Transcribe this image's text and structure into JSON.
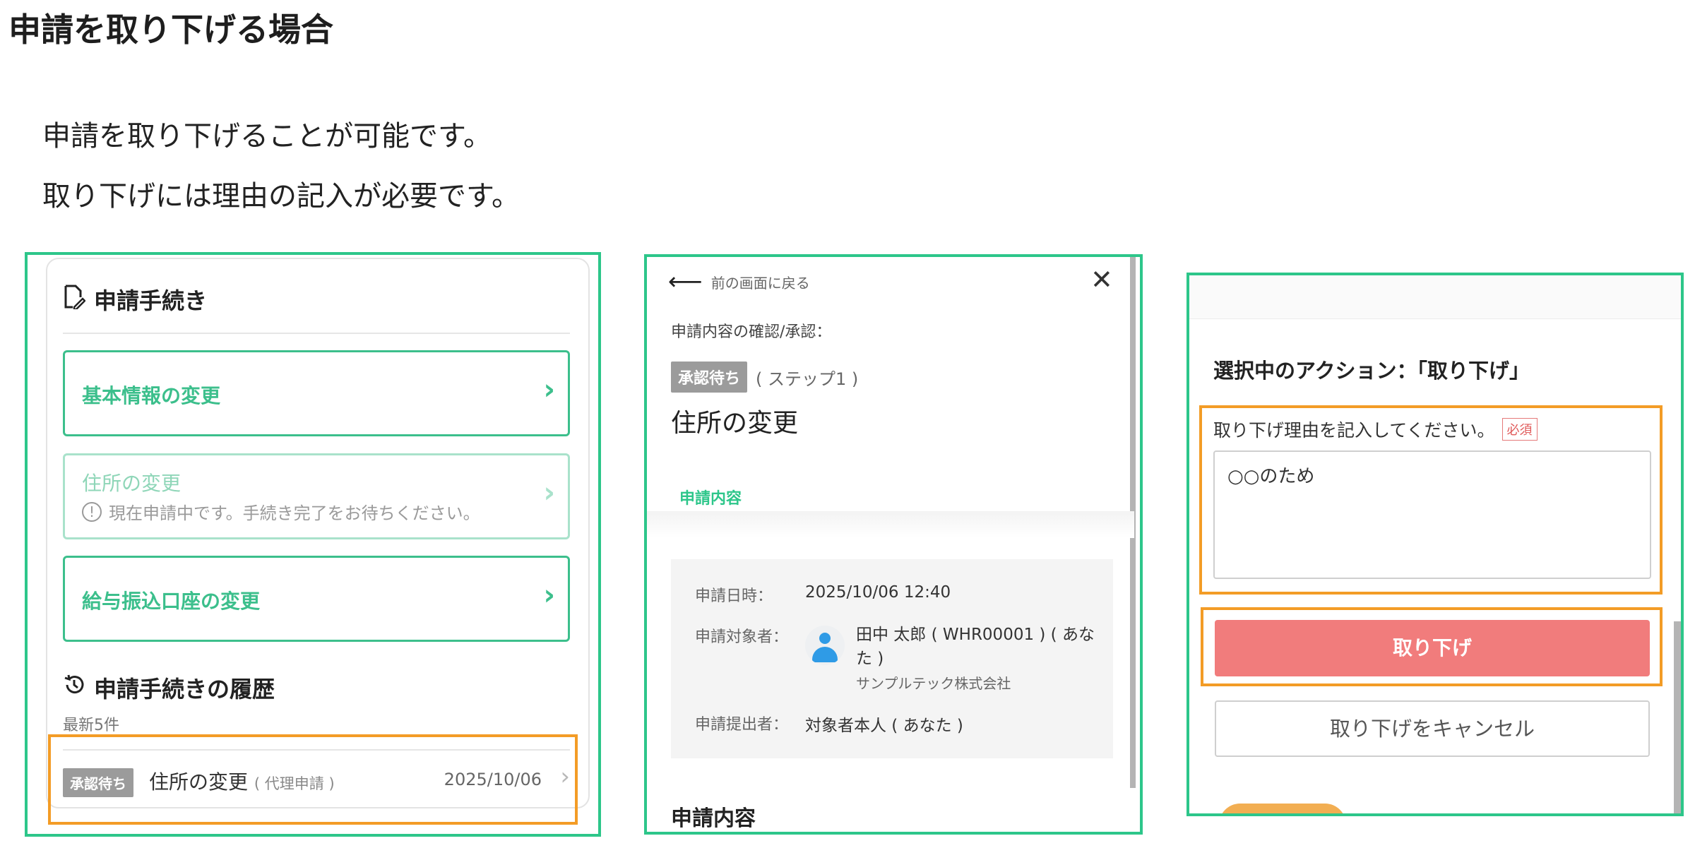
{
  "page": {
    "heading": "申請を取り下げる場合",
    "intro_line1": "申請を取り下げることが可能です。",
    "intro_line2": "取り下げには理由の記入が必要です。"
  },
  "panel1": {
    "title": "申請手続き",
    "menu": [
      {
        "label": "基本情報の変更"
      },
      {
        "label": "住所の変更",
        "note": "現在申請中です。手続き完了をお待ちください。"
      },
      {
        "label": "給与振込口座の変更"
      }
    ],
    "chevron": "›",
    "info_symbol": "!",
    "history_title": "申請手続きの履歴",
    "history_subtitle": "最新5件",
    "history_item": {
      "badge": "承認待ち",
      "name": "住所の変更",
      "sub": "( 代理申請 )",
      "date": "2025/10/06"
    }
  },
  "panel2": {
    "back_label": "前の画面に戻る",
    "back_arrow": "⟵",
    "close_symbol": "✕",
    "section_label": "申請内容の確認/承認：",
    "status_badge": "承認待ち",
    "step": "( ステップ1 )",
    "title": "住所の変更",
    "tab": "申請内容",
    "info": {
      "date_label": "申請日時：",
      "date_value": "2025/10/06 12:40",
      "target_label": "申請対象者：",
      "target_value": "田中 太郎 ( WHR00001 ) ( あなた )",
      "company": "サンプルテック株式会社",
      "submitter_label": "申請提出者：",
      "submitter_value": "対象者本人 ( あなた )"
    },
    "bottom_heading": "申請内容"
  },
  "panel3": {
    "action_label": "選択中のアクション：「取り下げ」",
    "reason_label": "取り下げ理由を記入してください。",
    "required_badge": "必須",
    "reason_value": "○○のため",
    "withdraw_button": "取り下げ",
    "cancel_button": "取り下げをキャンセル"
  },
  "colors": {
    "frame_green": "#2dc68a",
    "highlight_orange": "#f39c26",
    "accent_green": "#3cbf8c",
    "withdraw_red": "#f17c7c",
    "badge_gray": "#9b9b9b"
  },
  "icons": [
    "document-edit-icon",
    "chevron-right-icon",
    "info-icon",
    "history-icon",
    "back-arrow-icon",
    "close-icon",
    "user-avatar-icon"
  ]
}
